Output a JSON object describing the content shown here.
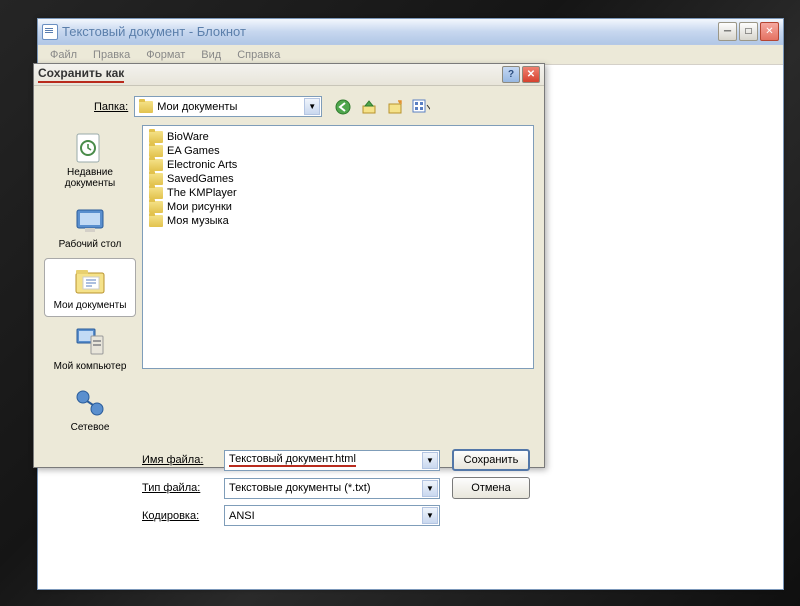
{
  "window": {
    "title": "Текстовый документ - Блокнот",
    "menu": [
      "Файл",
      "Правка",
      "Формат",
      "Вид",
      "Справка"
    ]
  },
  "dialog": {
    "title": "Сохранить как",
    "folder_label": "Папка:",
    "folder_value": "Мои документы",
    "sidebar": [
      {
        "label": "Недавние документы",
        "icon": "recent"
      },
      {
        "label": "Рабочий стол",
        "icon": "desktop"
      },
      {
        "label": "Мои документы",
        "icon": "mydocs"
      },
      {
        "label": "Мой компьютер",
        "icon": "computer"
      },
      {
        "label": "Сетевое",
        "icon": "network"
      }
    ],
    "files": [
      {
        "name": "BioWare",
        "type": "folder"
      },
      {
        "name": "EA Games",
        "type": "folder"
      },
      {
        "name": "Electronic Arts",
        "type": "folder"
      },
      {
        "name": "SavedGames",
        "type": "folder"
      },
      {
        "name": "The KMPlayer",
        "type": "folder"
      },
      {
        "name": "Мои рисунки",
        "type": "folder"
      },
      {
        "name": "Моя музыка",
        "type": "folder"
      }
    ],
    "filename_label": "Имя файла:",
    "filename_value": "Текстовый документ.html",
    "filetype_label": "Тип файла:",
    "filetype_value": "Текстовые документы (*.txt)",
    "encoding_label": "Кодировка:",
    "encoding_value": "ANSI",
    "save_btn": "Сохранить",
    "cancel_btn": "Отмена"
  }
}
